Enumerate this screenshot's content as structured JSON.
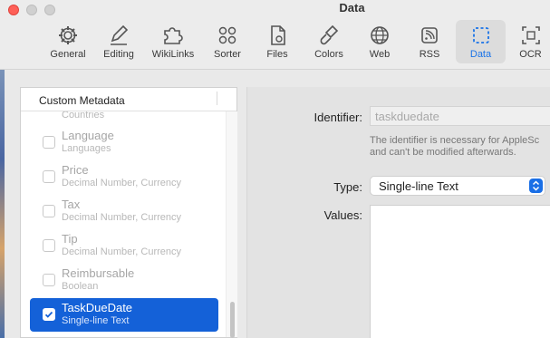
{
  "window": {
    "title": "Data"
  },
  "toolbar": {
    "items": [
      {
        "label": "General",
        "icon": "gear-icon"
      },
      {
        "label": "Editing",
        "icon": "pencil-icon"
      },
      {
        "label": "WikiLinks",
        "icon": "puzzle-icon"
      },
      {
        "label": "Sorter",
        "icon": "circles-icon"
      },
      {
        "label": "Files",
        "icon": "document-gear-icon"
      },
      {
        "label": "Colors",
        "icon": "brush-icon"
      },
      {
        "label": "Web",
        "icon": "globe-icon"
      },
      {
        "label": "RSS",
        "icon": "rss-icon"
      },
      {
        "label": "Data",
        "icon": "dashed-square-icon",
        "active": true
      },
      {
        "label": "OCR",
        "icon": "ocr-icon"
      }
    ],
    "accent": "#1a73e8"
  },
  "sidebar": {
    "header": "Custom Metadata",
    "partial_item_sub": "Countries",
    "items": [
      {
        "name": "Language",
        "sub": "Languages",
        "checked": false
      },
      {
        "name": "Price",
        "sub": "Decimal Number, Currency",
        "checked": false
      },
      {
        "name": "Tax",
        "sub": "Decimal Number, Currency",
        "checked": false
      },
      {
        "name": "Tip",
        "sub": "Decimal Number, Currency",
        "checked": false
      },
      {
        "name": "Reimbursable",
        "sub": "Boolean",
        "checked": false
      },
      {
        "name": "TaskDueDate",
        "sub": "Single-line Text",
        "checked": true,
        "selected": true
      }
    ],
    "selection_color": "#1461d8"
  },
  "detail": {
    "identifier_label": "Identifier:",
    "identifier_value": "taskduedate",
    "note_line1": "The identifier is necessary for AppleSc",
    "note_line2": "and can't be modified afterwards.",
    "type_label": "Type:",
    "type_value": "Single-line Text",
    "values_label": "Values:"
  }
}
